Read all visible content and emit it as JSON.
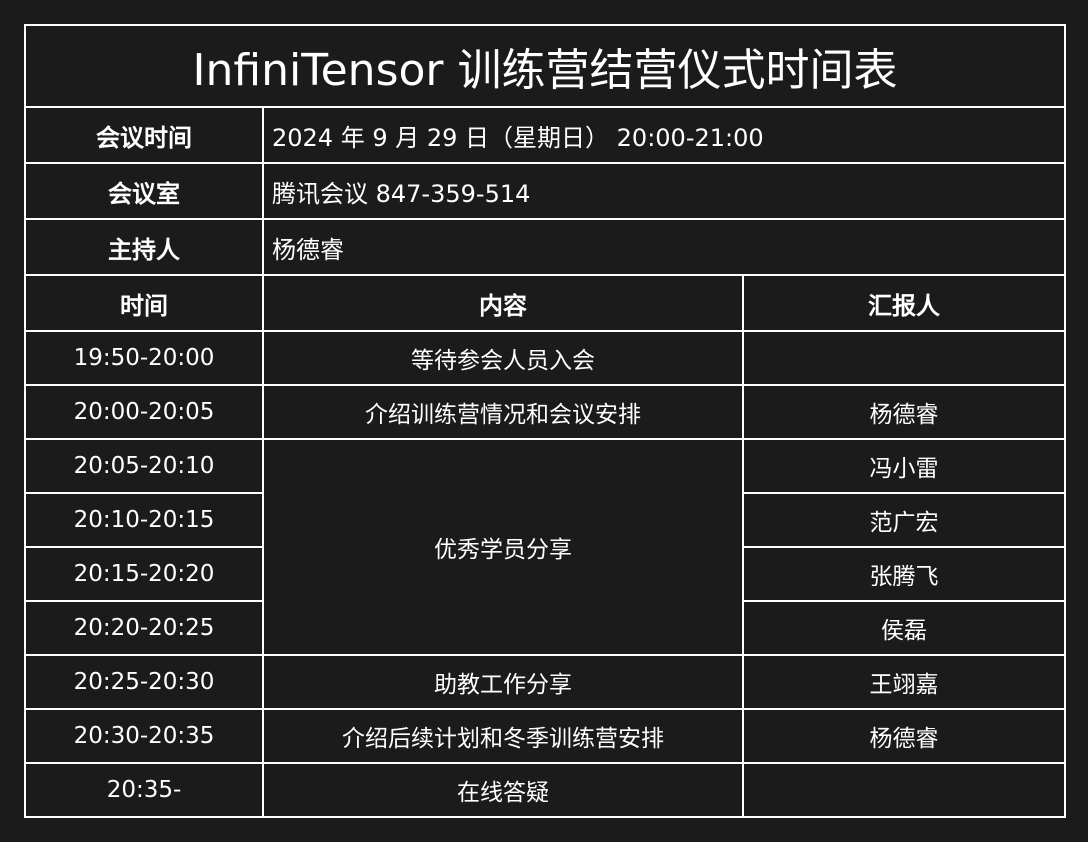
{
  "title": "InfiniTensor 训练营结营仪式时间表",
  "info": [
    {
      "label": "会议时间",
      "value": "2024 年 9 月 29 日（星期日） 20:00-21:00"
    },
    {
      "label": "会议室",
      "value": "腾讯会议 847-359-514"
    },
    {
      "label": "主持人",
      "value": "杨德睿"
    }
  ],
  "columns": {
    "time": "时间",
    "content": "内容",
    "presenter": "汇报人"
  },
  "rows": [
    {
      "time": "19:50-20:00",
      "content": "等待参会人员入会",
      "presenter": ""
    },
    {
      "time": "20:00-20:05",
      "content": "介绍训练营情况和会议安排",
      "presenter": "杨德睿"
    },
    {
      "time": "20:05-20:10",
      "content": "优秀学员分享",
      "presenter": "冯小雷"
    },
    {
      "time": "20:10-20:15",
      "content": "",
      "presenter": "范广宏"
    },
    {
      "time": "20:15-20:20",
      "content": "",
      "presenter": "张腾飞"
    },
    {
      "time": "20:20-20:25",
      "content": "",
      "presenter": "侯磊"
    },
    {
      "time": "20:25-20:30",
      "content": "助教工作分享",
      "presenter": "王翊嘉"
    },
    {
      "time": "20:30-20:35",
      "content": "介绍后续计划和冬季训练营安排",
      "presenter": "杨德睿"
    },
    {
      "time": "20:35-",
      "content": "在线答疑",
      "presenter": ""
    }
  ]
}
